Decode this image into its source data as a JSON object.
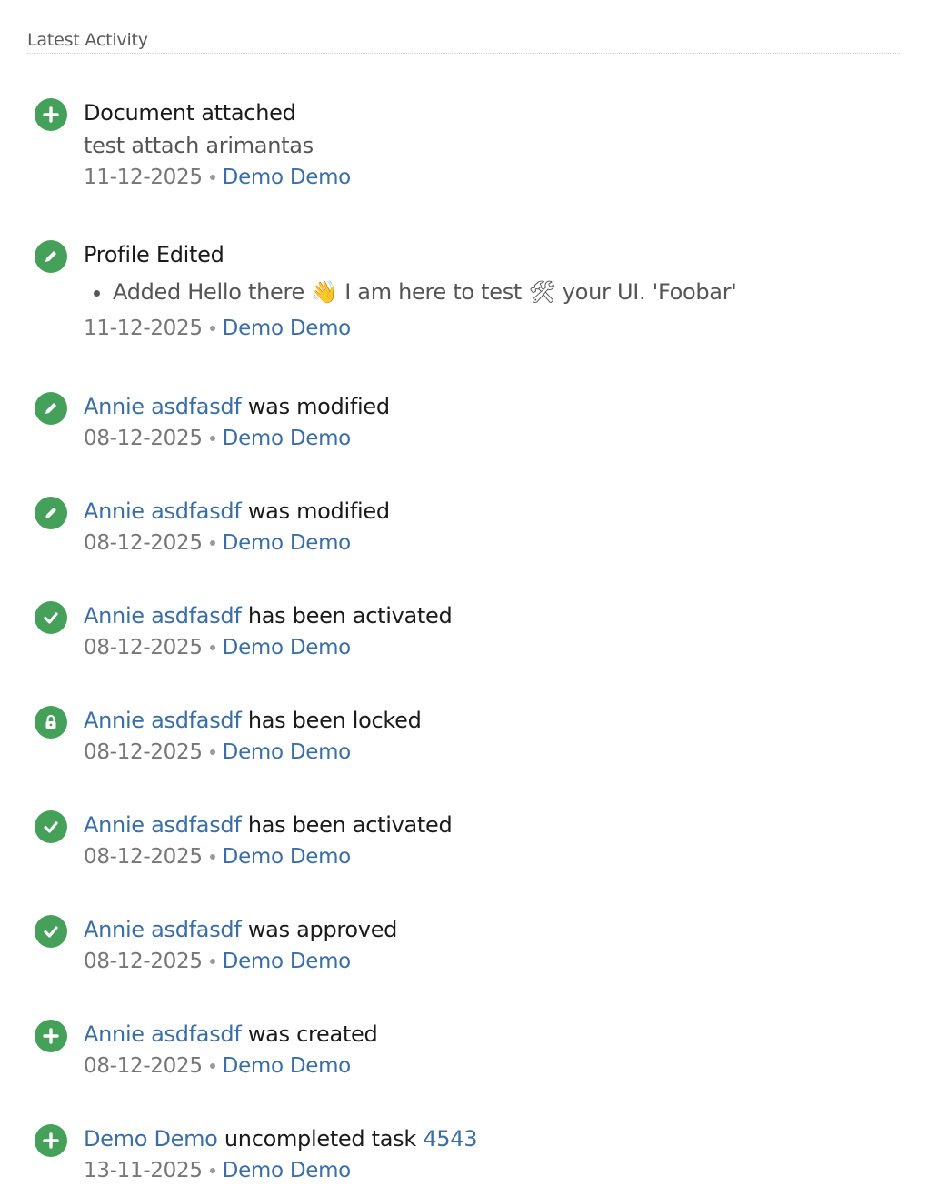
{
  "section": {
    "title": "Latest Activity"
  },
  "colors": {
    "icon_bg": "#45a05a",
    "link": "#3b6ea5",
    "meta_text": "#777777"
  },
  "activities": [
    {
      "icon": "plus-icon",
      "title": "Document attached",
      "subtitle": "test attach arimantas",
      "date": "11-12-2025",
      "author": "Demo Demo"
    },
    {
      "icon": "pencil-icon",
      "title": "Profile Edited",
      "changes": [
        "Added Hello there 👋 I am here to test 🛠 your UI. 'Foobar'"
      ],
      "date": "11-12-2025",
      "author": "Demo Demo"
    },
    {
      "icon": "pencil-icon",
      "subject": "Annie asdfasdf",
      "action": " was modified",
      "date": "08-12-2025",
      "author": "Demo Demo"
    },
    {
      "icon": "pencil-icon",
      "subject": "Annie asdfasdf",
      "action": " was modified",
      "date": "08-12-2025",
      "author": "Demo Demo"
    },
    {
      "icon": "check-icon",
      "subject": "Annie asdfasdf",
      "action": " has been activated",
      "date": "08-12-2025",
      "author": "Demo Demo"
    },
    {
      "icon": "lock-icon",
      "subject": "Annie asdfasdf",
      "action": " has been locked",
      "date": "08-12-2025",
      "author": "Demo Demo"
    },
    {
      "icon": "check-icon",
      "subject": "Annie asdfasdf",
      "action": " has been activated",
      "date": "08-12-2025",
      "author": "Demo Demo"
    },
    {
      "icon": "check-icon",
      "subject": "Annie asdfasdf",
      "action": " was approved",
      "date": "08-12-2025",
      "author": "Demo Demo"
    },
    {
      "icon": "plus-icon",
      "subject": "Annie asdfasdf",
      "action": " was created",
      "date": "08-12-2025",
      "author": "Demo Demo"
    },
    {
      "icon": "plus-icon",
      "subject": "Demo Demo",
      "action": " uncompleted task ",
      "object": "4543",
      "date": "13-11-2025",
      "author": "Demo Demo"
    }
  ]
}
